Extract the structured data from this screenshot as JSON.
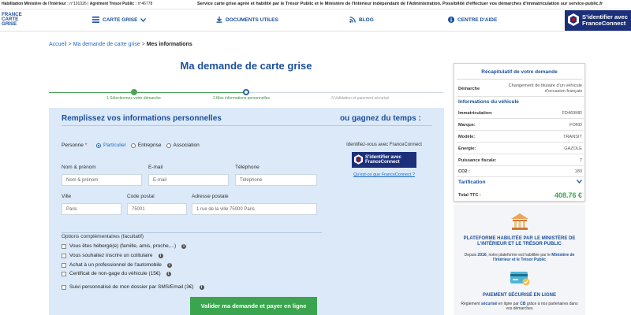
{
  "topbar": {
    "hab_label": "Habilitation Ministère de l'Intérieur :",
    "hab_value": "n°191026",
    "agr_label": "Agrément Trésor Public :",
    "agr_value": "n°46778",
    "notice": "Service carte grise agréé et habilité par le Trésor Public et le Ministère de l'Intérieur indépendant de l'Administration. Possibilité d'effectuer vos démarches d'immatriculation sur service-public.fr"
  },
  "nav": {
    "logo_lines": [
      "FRANCE",
      "CARTE",
      "GRISE"
    ],
    "items": [
      "CARTE GRISE",
      "DOCUMENTS UTILES",
      "BLOG",
      "CENTRE D'AIDE"
    ],
    "fc_line1": "S'identifier avec",
    "fc_line2": "FranceConnect"
  },
  "breadcrumb": {
    "home": "Accueil",
    "sep": ">",
    "step": "Ma demande de carte grise",
    "current": "Mes informations"
  },
  "page_title": "Ma demande de carte grise",
  "stepper": {
    "steps": [
      "1.Sélectionnez votre démarche",
      "2.Mes informations personnelles",
      "3.Validation et paiement sécurisé"
    ]
  },
  "form": {
    "heading": "Remplissez vos informations personnelles",
    "alt_heading": "ou gagnez du temps :",
    "person_label": "Personne",
    "person_req": "*:",
    "person_options": [
      "Particulier",
      "Entreprise",
      "Association"
    ],
    "fields": {
      "name": {
        "label": "Nom & prénom",
        "placeholder": "Nom & prénom"
      },
      "email": {
        "label": "E-mail",
        "placeholder": "E-mail"
      },
      "phone": {
        "label": "Téléphone",
        "placeholder": "Téléphone"
      },
      "city": {
        "label": "Ville",
        "placeholder": "Paris"
      },
      "postal": {
        "label": "Code postal",
        "placeholder": "75001"
      },
      "address": {
        "label": "Adresse postale",
        "placeholder": "1 rue de la ville 75000 Paris"
      }
    },
    "fc_text": "Identifiez-vous avec FranceConnect",
    "fc_line1": "S'identifier avec",
    "fc_line2": "FranceConnect",
    "fc_link": "Qu'est-ce que FranceConnect ?",
    "options_title": "Options complémentaires (facultatif)",
    "options": [
      "Vous êtes hébergé(e) (famille, amis, proche,...)",
      "Vous souhaitez inscrire un cotitulaire",
      "Achat à un professionnel de l'automobile",
      "Certificat de non-gage du véhicule (15€)",
      "Suivi personnalisé de mon dossier par SMS/Email (3€)"
    ],
    "info_glyph": "i",
    "submit": "Valider ma demande et payer en ligne"
  },
  "summary": {
    "title": "Récapitulatif de votre demande",
    "demarche_label": "Démarche",
    "demarche_value": "Changement de titulaire d'un véhicule d'occasion français",
    "vehicle_section": "Informations du véhicule",
    "rows": [
      {
        "k": "Immatriculation:",
        "v": "FD469MR"
      },
      {
        "k": "Marque:",
        "v": "FORD"
      },
      {
        "k": "Modèle:",
        "v": "TRANSIT"
      },
      {
        "k": "Energie:",
        "v": "GAZOLE"
      },
      {
        "k": "Puissance fiscale:",
        "v": "7"
      },
      {
        "k": "CO2 :",
        "v": "180"
      }
    ],
    "tarif_label": "Tarification",
    "total_label": "Total TTC :",
    "total_value": "408.76 €"
  },
  "right_panel": {
    "h1": "PLATEFORME HABILITÉE PAR LE MINISTÈRE DE L'INTÉRIEUR ET LE TRÉSOR PUBLIC",
    "p1_a": "Depuis ",
    "p1_b": "2016",
    "p1_c": ", notre plateforme est habilitée par le ",
    "p1_d": "Ministère de l'Intérieur et le Trésor Public",
    "h2": "PAIEMENT SÉCURISÉ EN LIGNE",
    "p2_a": "Règlement ",
    "p2_b": "sécurisé",
    "p2_c": " en ligne par ",
    "p2_d": "CB",
    "p2_e": " grâce à nos partenaires dans vos démarches"
  },
  "colors": {
    "brand_blue": "#1b4f9c",
    "panel_bg": "#dce9f8",
    "green": "#3aa54e",
    "fc_navy": "#1b2f7a"
  }
}
